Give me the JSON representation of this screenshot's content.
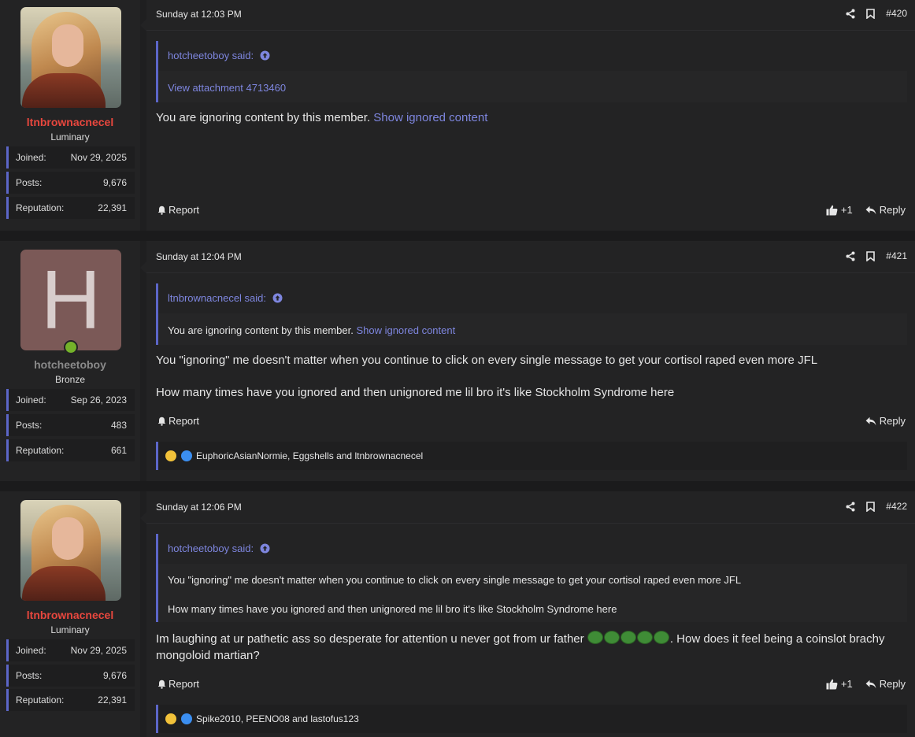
{
  "posts": [
    {
      "author": {
        "name": "ltnbrownacnecel",
        "title": "Luminary",
        "joined_label": "Joined:",
        "joined": "Nov 29, 2025",
        "posts_label": "Posts:",
        "posts": "9,676",
        "rep_label": "Reputation:",
        "reputation": "22,391"
      },
      "date": "Sunday at 12:03 PM",
      "number": "#420",
      "quote": {
        "author": "hotcheetoboy said:",
        "lines": [
          "View attachment 4713460"
        ]
      },
      "body": {
        "text": "You are ignoring content by this member.",
        "link": "Show ignored content"
      },
      "report_label": "Report",
      "like_count": "+1",
      "reply_label": "Reply"
    },
    {
      "author": {
        "name": "hotcheetoboy",
        "avatar_letter": "H",
        "title": "Bronze",
        "joined_label": "Joined:",
        "joined": "Sep 26, 2023",
        "posts_label": "Posts:",
        "posts": "483",
        "rep_label": "Reputation:",
        "reputation": "661"
      },
      "date": "Sunday at 12:04 PM",
      "number": "#421",
      "quote": {
        "author": "ltnbrownacnecel said:",
        "text": "You are ignoring content by this member.",
        "link": "Show ignored content"
      },
      "body": {
        "p1": "You \"ignoring\" me doesn't matter when you continue to click on every single message to get your cortisol raped even more JFL",
        "p2": "How many times have you ignored and then unignored me lil bro it's like Stockholm Syndrome here"
      },
      "report_label": "Report",
      "reply_label": "Reply",
      "reactions": "EuphoricAsianNormie, Eggshells and ltnbrownacnecel"
    },
    {
      "author": {
        "name": "ltnbrownacnecel",
        "title": "Luminary",
        "joined_label": "Joined:",
        "joined": "Nov 29, 2025",
        "posts_label": "Posts:",
        "posts": "9,676",
        "rep_label": "Reputation:",
        "reputation": "22,391"
      },
      "date": "Sunday at 12:06 PM",
      "number": "#422",
      "quote": {
        "author": "hotcheetoboy said:",
        "p1": "You \"ignoring\" me doesn't matter when you continue to click on every single message to get your cortisol raped even more JFL",
        "p2": "How many times have you ignored and then unignored me lil bro it's like Stockholm Syndrome here"
      },
      "body": {
        "before": "Im laughing at ur pathetic ass so desperate for attention u never got from ur father ",
        "after": ". How does it feel being a coinslot brachy mongoloid martian?"
      },
      "report_label": "Report",
      "like_count": "+1",
      "reply_label": "Reply",
      "reactions": "Spike2010, PEENO08 and lastofus123"
    }
  ],
  "colors": {
    "accent": "#5c66c8",
    "link": "#7e86df",
    "username_red": "#e8473e",
    "online": "#74b22a"
  },
  "icons": [
    "share-icon",
    "bookmark-icon",
    "bell-icon",
    "thumbs-up-icon",
    "reply-icon",
    "quote-up-icon",
    "laugh-emoji-icon",
    "like-reaction-icon",
    "pepe-emoji-icon"
  ]
}
